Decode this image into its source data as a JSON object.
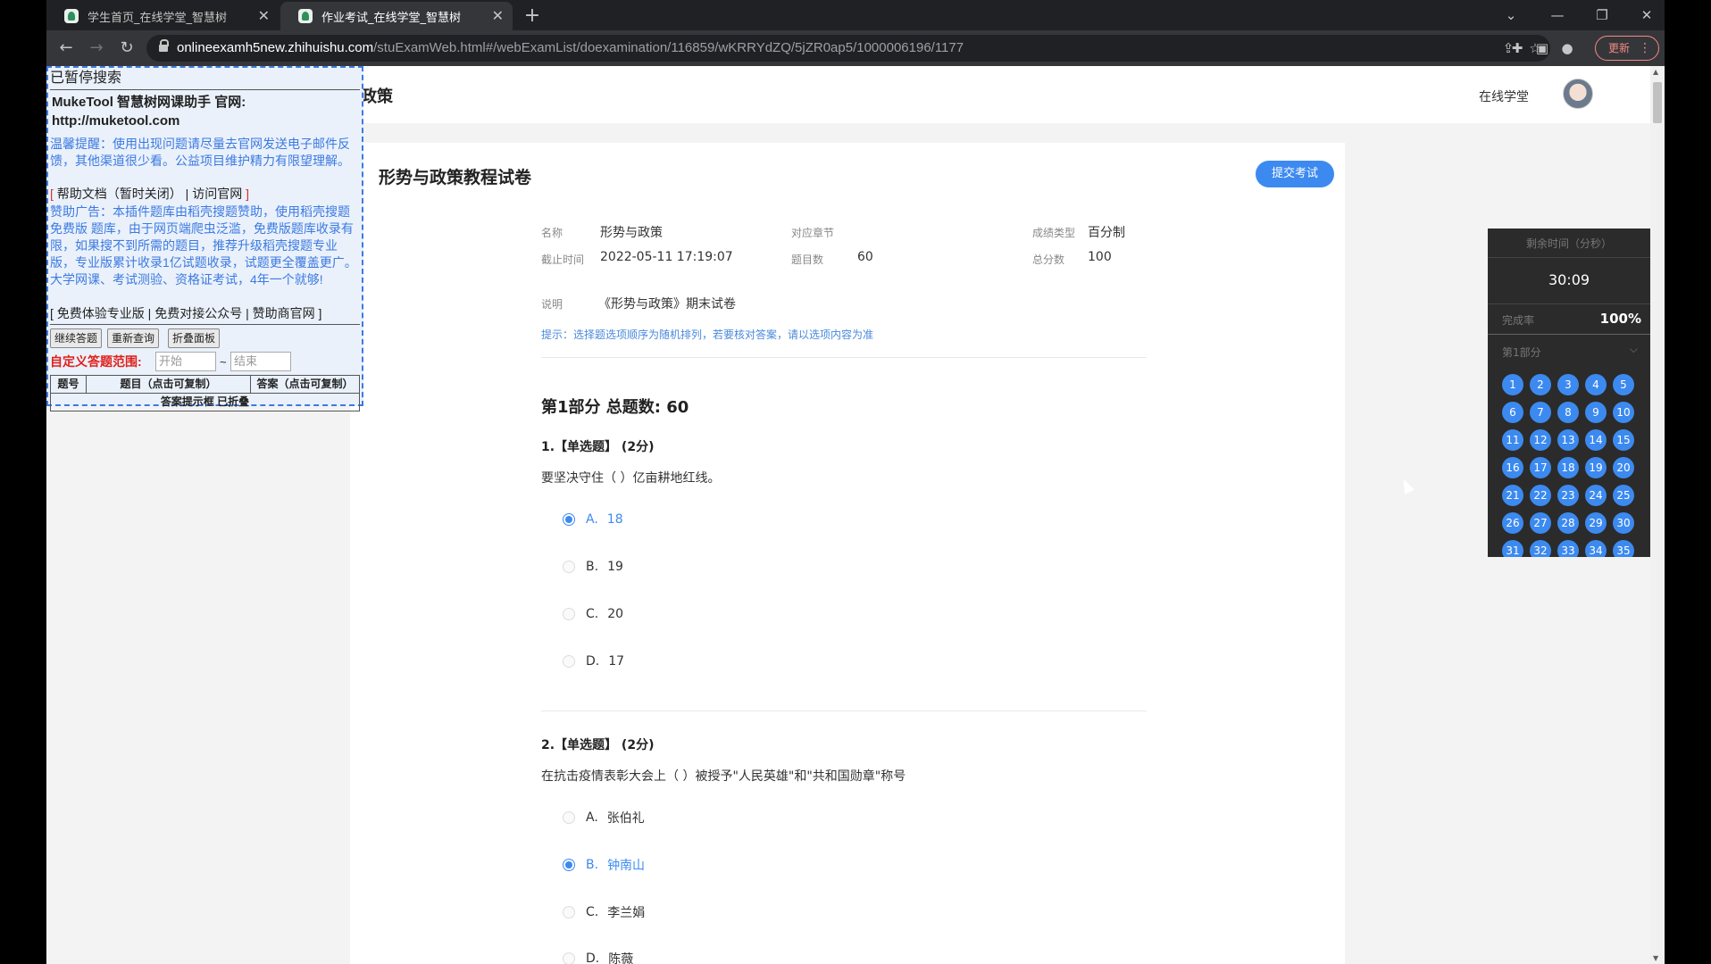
{
  "browser": {
    "tabs": [
      {
        "label": "学生首页_在线学堂_智慧树",
        "close": "✕"
      },
      {
        "label": "作业考试_在线学堂_智慧树",
        "close": "✕"
      }
    ],
    "new_tab": "+",
    "url_host": "onlineexamh5new.zhihuishu.com",
    "url_path": "/stuExamWeb.html#/webExamList/doexamination/116859/wKRRYdZQ/5jZR0ap5/1000006196/1177",
    "update_label": "更新",
    "menu_glyph": "⋮"
  },
  "helper": {
    "status": "已暂停搜索",
    "brand": "MukeTool 智慧树网课助手 官网: http://muketool.com",
    "tip": "温馨提醒：使用出现问题请尽量去官网发送电子邮件反馈，其他渠道很少看。公益项目维护精力有限望理解。",
    "links_open": "[",
    "help_doc": "帮助文档（暂时关闭）",
    "sep": "|",
    "visit_site": "访问官网",
    "links_close": "]",
    "ad": "赞助广告：本插件题库由稻壳搜题赞助，使用稻壳搜题 免费版 题库，由于网页端爬虫泛滥，免费版题库收录有限，如果搜不到所需的题目，推荐升级稻壳搜题专业版，专业版累计收录1亿试题收录，试题更全覆盖更广。大学网课、考试测验、资格证考试，4年一个就够!",
    "footer": "[ 免费体验专业版 | 免费对接公众号 | 赞助商官网 ]",
    "buttons": [
      "继续答题",
      "重新查询",
      "折叠面板"
    ],
    "range_label": "自定义答题范围:",
    "start_placeholder": "开始",
    "end_placeholder": "结束",
    "tilde": "~",
    "table_headers": [
      "题号",
      "题目（点击可复制）",
      "答案（点击可复制）"
    ],
    "folded_text": "答案提示框 已折叠"
  },
  "header": {
    "title": "政策",
    "online_link": "在线学堂"
  },
  "exam": {
    "title": "形势与政策教程试卷",
    "submit_label": "提交考试",
    "info": {
      "name_label": "名称",
      "name_value": "形势与政策",
      "chapter_label": "对应章节",
      "chapter_value": "",
      "grade_label": "成绩类型",
      "grade_value": "百分制",
      "deadline_label": "截止时间",
      "deadline_value": "2022-05-11 17:19:07",
      "count_label": "题目数",
      "count_value": "60",
      "total_label": "总分数",
      "total_value": "100",
      "desc_label": "说明",
      "desc_value": "《形势与政策》期末试卷"
    },
    "hint": "提示：选择题选项顺序为随机排列，若要核对答案，请以选项内容为准",
    "section_title": "第1部分  总题数: 60",
    "questions": [
      {
        "title": "1.【单选题】 (2分)",
        "text": "要坚决守住（ ）亿亩耕地红线。",
        "options": [
          {
            "letter": "A.",
            "text": "18",
            "selected": true
          },
          {
            "letter": "B.",
            "text": "19",
            "selected": false
          },
          {
            "letter": "C.",
            "text": "20",
            "selected": false
          },
          {
            "letter": "D.",
            "text": "17",
            "selected": false
          }
        ]
      },
      {
        "title": "2.【单选题】 (2分)",
        "text": "在抗击疫情表彰大会上（ ）被授予\"人民英雄\"和\"共和国勋章\"称号",
        "options": [
          {
            "letter": "A.",
            "text": "张伯礼",
            "selected": false
          },
          {
            "letter": "B.",
            "text": "钟南山",
            "selected": true
          },
          {
            "letter": "C.",
            "text": "李兰娟",
            "selected": false
          },
          {
            "letter": "D.",
            "text": "陈薇",
            "selected": false
          }
        ]
      }
    ]
  },
  "side": {
    "remain_label": "剩余时间（分秒）",
    "timer": "30:09",
    "rate_label": "完成率",
    "rate_value": "100%",
    "part_label": "第1部分",
    "numbers": [
      "1",
      "2",
      "3",
      "4",
      "5",
      "6",
      "7",
      "8",
      "9",
      "10",
      "11",
      "12",
      "13",
      "14",
      "15",
      "16",
      "17",
      "18",
      "19",
      "20",
      "21",
      "22",
      "23",
      "24",
      "25",
      "26",
      "27",
      "28",
      "29",
      "30",
      "31",
      "32",
      "33",
      "34",
      "35"
    ]
  },
  "colors": {
    "accent": "#3c8af0",
    "overlay_border": "#3c7ae0",
    "warning": "#e0201a"
  }
}
